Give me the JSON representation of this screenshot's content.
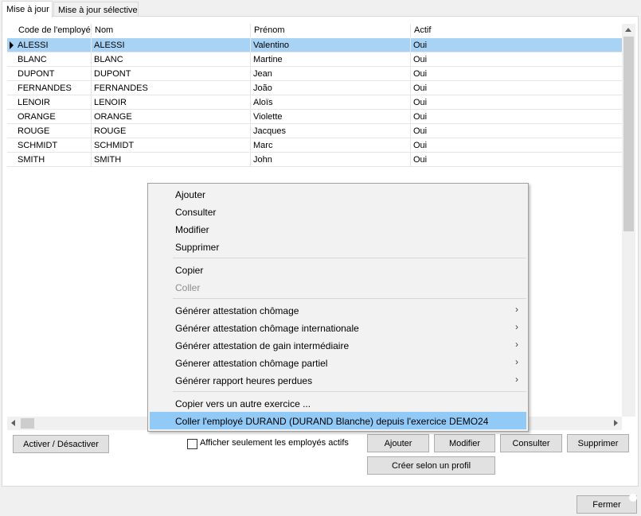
{
  "tabs": [
    {
      "label": "Mise à jour",
      "active": true
    },
    {
      "label": "Mise à jour sélective",
      "active": false
    }
  ],
  "grid": {
    "columns": [
      "Code de l'employé",
      "Nom",
      "Prénom",
      "Actif"
    ],
    "rows": [
      [
        "ALESSI",
        "ALESSI",
        "Valentino",
        "Oui"
      ],
      [
        "BLANC",
        "BLANC",
        "Martine",
        "Oui"
      ],
      [
        "DUPONT",
        "DUPONT",
        "Jean",
        "Oui"
      ],
      [
        "FERNANDES",
        "FERNANDES",
        "João",
        "Oui"
      ],
      [
        "LENOIR",
        "LENOIR",
        "Aloïs",
        "Oui"
      ],
      [
        "ORANGE",
        "ORANGE",
        "Violette",
        "Oui"
      ],
      [
        "ROUGE",
        "ROUGE",
        "Jacques",
        "Oui"
      ],
      [
        "SCHMIDT",
        "SCHMIDT",
        "Marc",
        "Oui"
      ],
      [
        "SMITH",
        "SMITH",
        "John",
        "Oui"
      ]
    ],
    "selected_row": 0
  },
  "buttons": {
    "toggle": "Activer / Désactiver",
    "add": "Ajouter",
    "modify": "Modifier",
    "consult": "Consulter",
    "delete": "Supprimer",
    "create_profile": "Créer selon un profil",
    "close": "Fermer"
  },
  "filter": {
    "label": "Afficher seulement les employés actifs",
    "checked": false
  },
  "context_menu": {
    "items": [
      {
        "label": "Ajouter"
      },
      {
        "label": "Consulter"
      },
      {
        "label": "Modifier"
      },
      {
        "label": "Supprimer"
      },
      {
        "label": "Copier"
      },
      {
        "label": "Coller",
        "disabled": true
      },
      {
        "label": "Générer attestation chômage",
        "submenu": true
      },
      {
        "label": "Générer attestation chômage internationale",
        "submenu": true
      },
      {
        "label": "Générer attestation de gain intermédiaire",
        "submenu": true
      },
      {
        "label": "Génerer attestation chômage partiel",
        "submenu": true
      },
      {
        "label": "Générer rapport heures perdues",
        "submenu": true
      },
      {
        "label": "Copier vers un autre exercice ..."
      },
      {
        "label": "Coller l'employé  DURAND (DURAND Blanche)  depuis l'exercice  DEMO24",
        "highlighted": true
      }
    ]
  },
  "icons": {
    "row_indicator": "current-row-arrow-icon",
    "submenu": "chevron-right-icon",
    "scroll_left": "arrow-left-icon",
    "scroll_right": "arrow-right-icon",
    "scroll_up": "arrow-up-icon"
  },
  "colors": {
    "selection": "#a8d3f5",
    "menu_highlight": "#91c9f7"
  }
}
